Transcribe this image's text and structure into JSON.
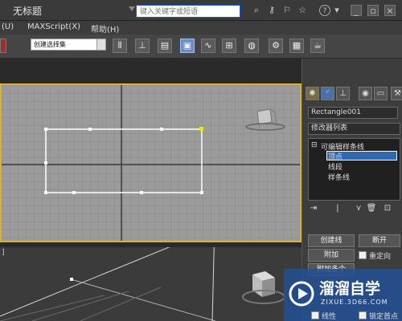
{
  "window": {
    "title": "无标题"
  },
  "search": {
    "placeholder": "键入关键字或短语"
  },
  "menu": {
    "items": [
      "(U)",
      "MAXScript(X)",
      "帮助(H)"
    ]
  },
  "toolbar": {
    "selection_set": "创建选择集"
  },
  "viewports": {
    "perspective_left_label": "]"
  },
  "panel": {
    "object_name": "Rectangle001",
    "modifier_list": "修改器列表",
    "stack": {
      "root": "可编辑样条线",
      "items": [
        "顶点",
        "线段",
        "样条线"
      ]
    },
    "buttons": {
      "create_line": "创建线",
      "break": "断开",
      "attach": "附加",
      "reorient": "重定向",
      "attach_multiple": "附加多个",
      "line": "线性",
      "bind_first": "锁定首点"
    }
  },
  "watermark": {
    "name": "溜溜自学",
    "url": "ZIXUE.3D66.COM"
  },
  "colors": {
    "selection": "#d7b431",
    "stack_selected": "#2f67b5"
  }
}
